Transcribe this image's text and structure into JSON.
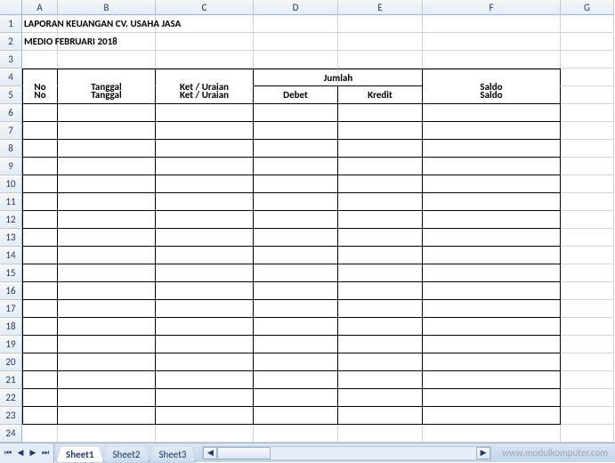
{
  "columns": [
    "A",
    "B",
    "C",
    "D",
    "E",
    "F",
    "G"
  ],
  "rows": [
    1,
    2,
    3,
    4,
    5,
    6,
    7,
    8,
    9,
    10,
    11,
    12,
    13,
    14,
    15,
    16,
    17,
    18,
    19,
    20,
    21,
    22,
    23,
    24
  ],
  "title1": "LAPORAN KEUANGAN CV. USAHA JASA",
  "title2": "MEDIO FEBRUARI 2018",
  "headers": {
    "no": "No",
    "tanggal": "Tanggal",
    "ket": "Ket / Uraian",
    "jumlah": "Jumlah",
    "debet": "Debet",
    "kredit": "Kredit",
    "saldo": "Saldo"
  },
  "tabs": {
    "t1": "Sheet1",
    "t2": "Sheet2",
    "t3": "Sheet3"
  },
  "watermark": "www.modulkomputer.com",
  "nav": {
    "first": "⏮",
    "prev": "◀",
    "next": "▶",
    "last": "⏭",
    "left": "◀",
    "right": "▶"
  }
}
